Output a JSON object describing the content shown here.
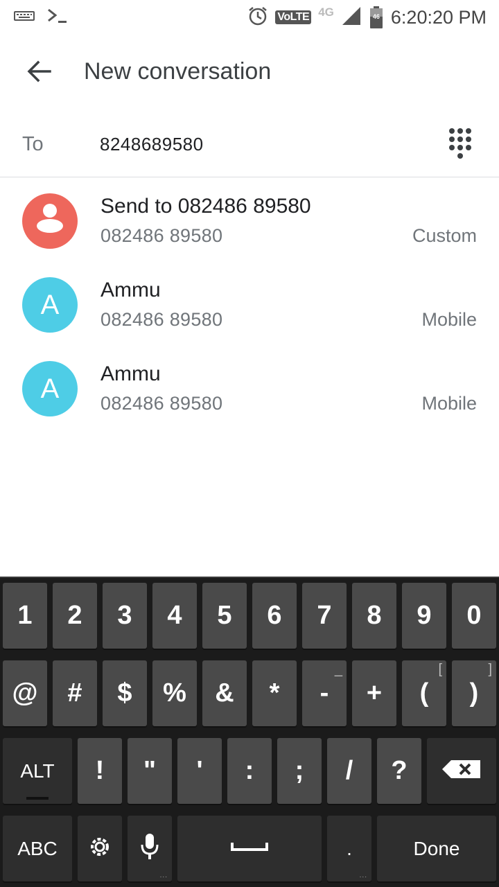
{
  "status_bar": {
    "time": "6:20:20 PM",
    "volte": "VoLTE",
    "network": "4G",
    "battery_label": "46"
  },
  "app_bar": {
    "title": "New conversation"
  },
  "to_field": {
    "label": "To",
    "value": "8248689580"
  },
  "suggestions": [
    {
      "name": "Send to 082486 89580",
      "number": "082486 89580",
      "type": "Custom",
      "avatar_letter": "",
      "avatar_color": "#EE675C"
    },
    {
      "name": "Ammu",
      "number": "082486 89580",
      "type": "Mobile",
      "avatar_letter": "A",
      "avatar_color": "#4ECDE6"
    },
    {
      "name": "Ammu",
      "number": "082486 89580",
      "type": "Mobile",
      "avatar_letter": "A",
      "avatar_color": "#4ECDE6"
    }
  ],
  "keyboard": {
    "row1": [
      "1",
      "2",
      "3",
      "4",
      "5",
      "6",
      "7",
      "8",
      "9",
      "0"
    ],
    "row2": [
      "@",
      "#",
      "$",
      "%",
      "&",
      "*",
      "-",
      "+",
      "(",
      ")"
    ],
    "row2_subs": [
      "",
      "",
      "",
      "",
      "",
      "",
      "_",
      "",
      "[",
      "]"
    ],
    "row3": [
      "!",
      "\"",
      "'",
      ":",
      ";",
      "/",
      "?"
    ],
    "alt_label": "ALT",
    "abc_label": "ABC",
    "period_label": ".",
    "done_label": "Done"
  }
}
